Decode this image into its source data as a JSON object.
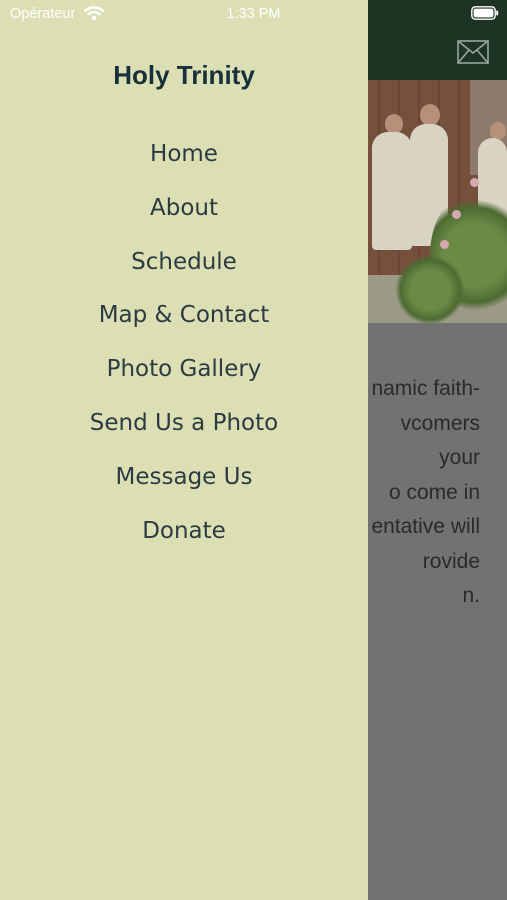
{
  "status_bar": {
    "carrier": "Opérateur",
    "time": "1:33 PM",
    "wifi_icon": "wifi-icon",
    "battery_icon": "battery-icon"
  },
  "header": {
    "mail_icon": "envelope-icon",
    "background_color": "#1d3324"
  },
  "hero_image": {
    "description_icon": "photo-procession"
  },
  "body_text_fragments": [
    "namic faith-",
    "vcomers",
    "your",
    "o come in",
    "entative will",
    "rovide",
    "n."
  ],
  "drawer": {
    "title": "Holy Trinity",
    "background_color": "#dcdfb3",
    "items": [
      {
        "label": "Home"
      },
      {
        "label": "About"
      },
      {
        "label": "Schedule"
      },
      {
        "label": "Map & Contact"
      },
      {
        "label": "Photo Gallery"
      },
      {
        "label": "Send Us a Photo"
      },
      {
        "label": "Message Us"
      },
      {
        "label": "Donate"
      }
    ]
  }
}
